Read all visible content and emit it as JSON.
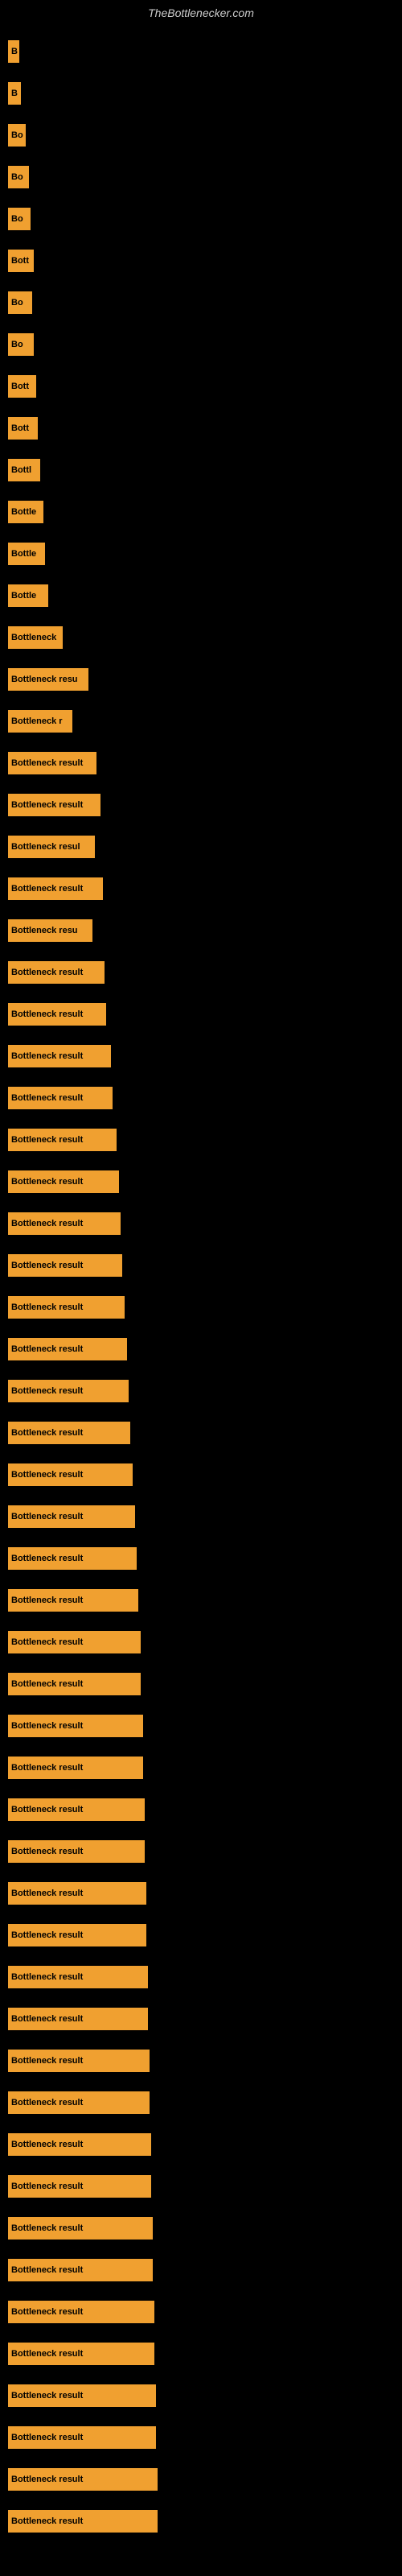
{
  "site_title": "TheBottlenecker.com",
  "bars": [
    {
      "label": "B",
      "width": 14
    },
    {
      "label": "B",
      "width": 16
    },
    {
      "label": "Bo",
      "width": 22
    },
    {
      "label": "Bo",
      "width": 26
    },
    {
      "label": "Bo",
      "width": 28
    },
    {
      "label": "Bott",
      "width": 32
    },
    {
      "label": "Bo",
      "width": 30
    },
    {
      "label": "Bo",
      "width": 32
    },
    {
      "label": "Bott",
      "width": 35
    },
    {
      "label": "Bott",
      "width": 37
    },
    {
      "label": "Bottl",
      "width": 40
    },
    {
      "label": "Bottle",
      "width": 44
    },
    {
      "label": "Bottle",
      "width": 46
    },
    {
      "label": "Bottle",
      "width": 50
    },
    {
      "label": "Bottleneck",
      "width": 68
    },
    {
      "label": "Bottleneck resu",
      "width": 100
    },
    {
      "label": "Bottleneck r",
      "width": 80
    },
    {
      "label": "Bottleneck result",
      "width": 110
    },
    {
      "label": "Bottleneck result",
      "width": 115
    },
    {
      "label": "Bottleneck resul",
      "width": 108
    },
    {
      "label": "Bottleneck result",
      "width": 118
    },
    {
      "label": "Bottleneck resu",
      "width": 105
    },
    {
      "label": "Bottleneck result",
      "width": 120
    },
    {
      "label": "Bottleneck result",
      "width": 122
    },
    {
      "label": "Bottleneck result",
      "width": 128
    },
    {
      "label": "Bottleneck result",
      "width": 130
    },
    {
      "label": "Bottleneck result",
      "width": 135
    },
    {
      "label": "Bottleneck result",
      "width": 138
    },
    {
      "label": "Bottleneck result",
      "width": 140
    },
    {
      "label": "Bottleneck result",
      "width": 142
    },
    {
      "label": "Bottleneck result",
      "width": 145
    },
    {
      "label": "Bottleneck result",
      "width": 148
    },
    {
      "label": "Bottleneck result",
      "width": 150
    },
    {
      "label": "Bottleneck result",
      "width": 152
    },
    {
      "label": "Bottleneck result",
      "width": 155
    },
    {
      "label": "Bottleneck result",
      "width": 158
    },
    {
      "label": "Bottleneck result",
      "width": 160
    },
    {
      "label": "Bottleneck result",
      "width": 162
    },
    {
      "label": "Bottleneck result",
      "width": 165
    },
    {
      "label": "Bottleneck result",
      "width": 165
    },
    {
      "label": "Bottleneck result",
      "width": 168
    },
    {
      "label": "Bottleneck result",
      "width": 168
    },
    {
      "label": "Bottleneck result",
      "width": 170
    },
    {
      "label": "Bottleneck result",
      "width": 170
    },
    {
      "label": "Bottleneck result",
      "width": 172
    },
    {
      "label": "Bottleneck result",
      "width": 172
    },
    {
      "label": "Bottleneck result",
      "width": 174
    },
    {
      "label": "Bottleneck result",
      "width": 174
    },
    {
      "label": "Bottleneck result",
      "width": 176
    },
    {
      "label": "Bottleneck result",
      "width": 176
    },
    {
      "label": "Bottleneck result",
      "width": 178
    },
    {
      "label": "Bottleneck result",
      "width": 178
    },
    {
      "label": "Bottleneck result",
      "width": 180
    },
    {
      "label": "Bottleneck result",
      "width": 180
    },
    {
      "label": "Bottleneck result",
      "width": 182
    },
    {
      "label": "Bottleneck result",
      "width": 182
    },
    {
      "label": "Bottleneck result",
      "width": 184
    },
    {
      "label": "Bottleneck result",
      "width": 184
    },
    {
      "label": "Bottleneck result",
      "width": 186
    },
    {
      "label": "Bottleneck result",
      "width": 186
    }
  ]
}
